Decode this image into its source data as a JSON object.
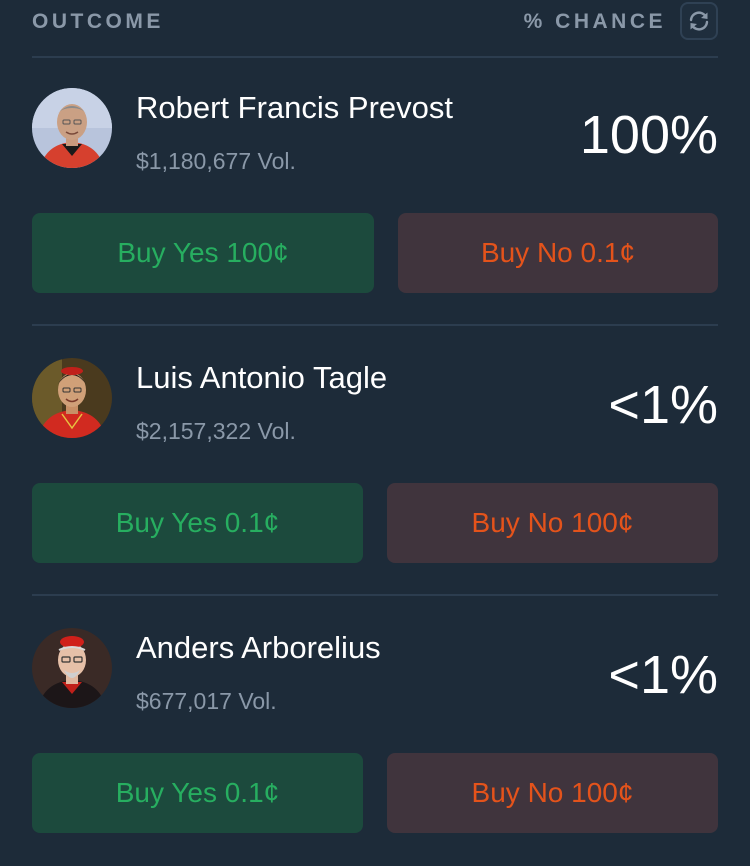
{
  "header": {
    "outcome_label": "OUTCOME",
    "chance_label": "% CHANCE",
    "refresh_icon": "refresh-icon"
  },
  "colors": {
    "background": "#1d2b39",
    "divider": "#2c3d4f",
    "yes_bg": "#1c4a3d",
    "yes_text": "#27ae60",
    "no_bg": "#40343d",
    "no_text": "#e4531b"
  },
  "outcomes": [
    {
      "name": "Robert Francis Prevost",
      "volume": "$1,180,677 Vol.",
      "chance": "100%",
      "buy_yes": "Buy Yes 100¢",
      "buy_no": "Buy No 0.1¢"
    },
    {
      "name": "Luis Antonio Tagle",
      "volume": "$2,157,322 Vol.",
      "chance": "<1%",
      "buy_yes": "Buy Yes 0.1¢",
      "buy_no": "Buy No 100¢"
    },
    {
      "name": "Anders Arborelius",
      "volume": "$677,017 Vol.",
      "chance": "<1%",
      "buy_yes": "Buy Yes 0.1¢",
      "buy_no": "Buy No 100¢"
    }
  ]
}
